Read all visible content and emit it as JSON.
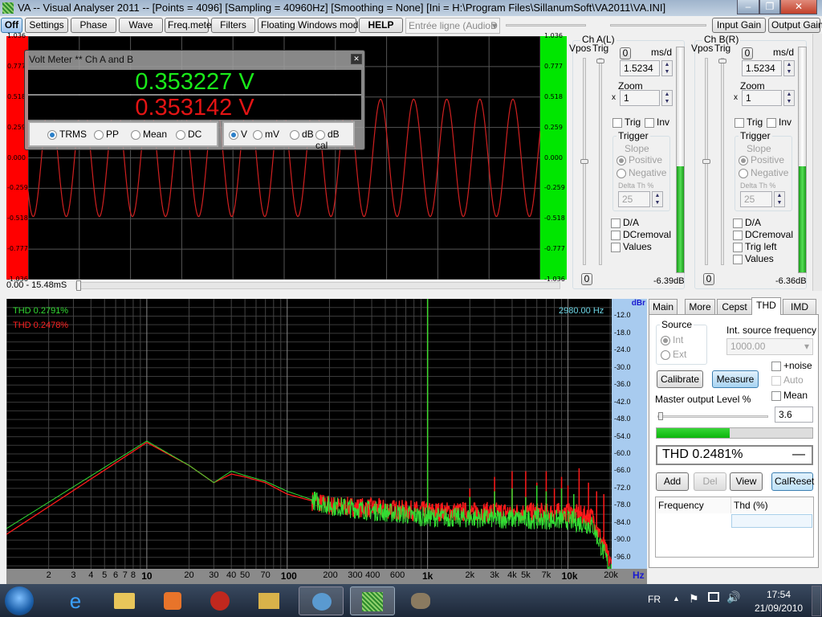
{
  "window": {
    "title": "VA -- Visual Analyser 2011 --  [Points = 4096]  [Sampling = 40960Hz]  [Smoothing = None]  [Ini = H:\\Program Files\\SillanumSoft\\VA2011\\VA.INI]",
    "minimize": "–",
    "maximize": "❐",
    "close": "✕"
  },
  "toolbar": {
    "off": "Off",
    "settings": "Settings",
    "phase": "Phase",
    "wave": "Wave",
    "freqmeter": "Freq.meter",
    "filters": "Filters",
    "floating": "Floating Windows mode",
    "help": "HELP",
    "input_device": "Entrée ligne (AudioD",
    "input_gain": "Input Gain",
    "output_gain": "Output Gain"
  },
  "scope": {
    "y_ticks": [
      "1.036",
      "0.777",
      "0.518",
      "0.259",
      "0.000",
      "-0.259",
      "-0.518",
      "-0.777",
      "-1.036"
    ],
    "time_range": "0.00 - 15.48mS",
    "ch_a_color": "#ff0000",
    "ch_b_color": "#00e600",
    "signal_freq_hz": 1000,
    "amplitude_v": 0.5
  },
  "voltmeter": {
    "title": "Volt Meter ** Ch A and B",
    "ch_a": "0.353227 V",
    "ch_b": "0.353142 V",
    "modes": [
      "TRMS",
      "PP",
      "Mean",
      "DC"
    ],
    "mode_selected": "TRMS",
    "units": [
      "V",
      "mV",
      "dB",
      "dB cal"
    ],
    "unit_selected": "V"
  },
  "channels": [
    {
      "title": "Ch A(L)",
      "vpos": "Vpos",
      "trig": "Trig",
      "zero_btn": "0",
      "msd_label": "ms/d",
      "msd": "1.5234",
      "zoom_label": "Zoom",
      "zoom_x": "x",
      "zoom": "1",
      "trig_chk": "Trig",
      "inv_chk": "Inv",
      "trigger_title": "Trigger",
      "slope": "Slope",
      "positive": "Positive",
      "negative": "Negative",
      "delta_label": "Delta Th %",
      "delta": "25",
      "options": [
        "D/A",
        "DCremoval",
        "Values"
      ],
      "bottom_btn": "0",
      "level": "-6.39dB",
      "level_fraction": 0.47
    },
    {
      "title": "Ch B(R)",
      "vpos": "Vpos",
      "trig": "Trig",
      "zero_btn": "0",
      "msd_label": "ms/d",
      "msd": "1.5234",
      "zoom_label": "Zoom",
      "zoom_x": "x",
      "zoom": "1",
      "trig_chk": "Trig",
      "inv_chk": "Inv",
      "trigger_title": "Trigger",
      "slope": "Slope",
      "positive": "Positive",
      "negative": "Negative",
      "delta_label": "Delta Th %",
      "delta": "25",
      "options": [
        "D/A",
        "DCremoval",
        "Trig left",
        "Values"
      ],
      "bottom_btn": "0",
      "level": "-6.36dB",
      "level_fraction": 0.47
    }
  ],
  "chart_data": {
    "type": "line",
    "xscale": "log",
    "xlim": [
      1,
      20480
    ],
    "ylim": [
      -100,
      -6
    ],
    "yunit": "dBr",
    "xunit": "Hz",
    "grid": true,
    "y_ticks": [
      "-12.0",
      "-18.0",
      "-24.0",
      "-30.0",
      "-36.0",
      "-42.0",
      "-48.0",
      "-54.0",
      "-60.0",
      "-66.0",
      "-72.0",
      "-78.0",
      "-84.0",
      "-90.0",
      "-96.0"
    ],
    "x_ticks": [
      {
        "v": 2,
        "l": "2"
      },
      {
        "v": 3,
        "l": "3"
      },
      {
        "v": 4,
        "l": "4"
      },
      {
        "v": 5,
        "l": "5"
      },
      {
        "v": 6,
        "l": "6"
      },
      {
        "v": 7,
        "l": "7"
      },
      {
        "v": 8,
        "l": "8"
      },
      {
        "v": 10,
        "l": "10",
        "b": true
      },
      {
        "v": 20,
        "l": "20"
      },
      {
        "v": 30,
        "l": "30"
      },
      {
        "v": 40,
        "l": "40"
      },
      {
        "v": 50,
        "l": "50"
      },
      {
        "v": 70,
        "l": "70"
      },
      {
        "v": 100,
        "l": "100",
        "b": true
      },
      {
        "v": 200,
        "l": "200"
      },
      {
        "v": 300,
        "l": "300"
      },
      {
        "v": 400,
        "l": "400"
      },
      {
        "v": 600,
        "l": "600"
      },
      {
        "v": 1000,
        "l": "1k",
        "b": true
      },
      {
        "v": 2000,
        "l": "2k"
      },
      {
        "v": 3000,
        "l": "3k"
      },
      {
        "v": 4000,
        "l": "4k"
      },
      {
        "v": 5000,
        "l": "5k"
      },
      {
        "v": 7000,
        "l": "7k"
      },
      {
        "v": 10000,
        "l": "10k",
        "b": true
      },
      {
        "v": 20000,
        "l": "20k"
      }
    ],
    "cursor_readout": "2980.00 Hz",
    "series": [
      {
        "name": "THD 0.2791%",
        "color": "#33dd33",
        "envelope": [
          [
            1,
            -86
          ],
          [
            10,
            -55.5
          ],
          [
            20,
            -64
          ],
          [
            30,
            -70
          ],
          [
            40,
            -66
          ],
          [
            50,
            -67.5
          ],
          [
            70,
            -69.5
          ],
          [
            100,
            -73
          ],
          [
            200,
            -78
          ],
          [
            1000,
            -82
          ],
          [
            10000,
            -83
          ],
          [
            15000,
            -85
          ],
          [
            20000,
            -100
          ]
        ],
        "peaks": [
          [
            1000,
            -6
          ],
          [
            2000,
            -75
          ],
          [
            3000,
            -73
          ],
          [
            4000,
            -72
          ],
          [
            5000,
            -75
          ],
          [
            6000,
            -71
          ],
          [
            7000,
            -73
          ],
          [
            9000,
            -72
          ],
          [
            11000,
            -74
          ]
        ]
      },
      {
        "name": "THD 0.2478%",
        "color": "#ff1a1a",
        "envelope": [
          [
            1,
            -88
          ],
          [
            10,
            -56
          ],
          [
            20,
            -64
          ],
          [
            30,
            -70
          ],
          [
            40,
            -67
          ],
          [
            50,
            -68
          ],
          [
            70,
            -70
          ],
          [
            100,
            -74
          ],
          [
            200,
            -78
          ],
          [
            1000,
            -80
          ],
          [
            10000,
            -80.5
          ],
          [
            15000,
            -82
          ],
          [
            20000,
            -98
          ]
        ],
        "peaks": [
          [
            1000,
            -6
          ],
          [
            2000,
            -72
          ],
          [
            3000,
            -68
          ],
          [
            4000,
            -66
          ],
          [
            5000,
            -66
          ],
          [
            6000,
            -70
          ],
          [
            7000,
            -66
          ],
          [
            8000,
            -72
          ],
          [
            9000,
            -68
          ],
          [
            10000,
            -71
          ],
          [
            12000,
            -65
          ],
          [
            14000,
            -70
          ],
          [
            16000,
            -73
          ],
          [
            18000,
            -74
          ]
        ]
      }
    ]
  },
  "thd": {
    "tabs": [
      "Main",
      "More",
      "Cepst",
      "THD",
      "IMD"
    ],
    "active_tab": "THD",
    "source_title": "Source",
    "int": "Int",
    "ext": "Ext",
    "int_freq_label": "Int. source frequency",
    "int_freq": "1000.00",
    "noise": "+noise",
    "auto": "Auto",
    "mean": "Mean",
    "calibrate": "Calibrate",
    "measure": "Measure",
    "master_label": "Master output Level %",
    "master": "3.6",
    "progress": 0.47,
    "result": "THD 0.2481%",
    "result_sign": "—",
    "add": "Add",
    "del": "Del",
    "view": "View",
    "calreset": "CalReset",
    "col_freq": "Frequency",
    "col_thd": "Thd (%)"
  },
  "taskbar": {
    "lang": "FR",
    "time": "17:54",
    "date": "21/09/2010"
  }
}
